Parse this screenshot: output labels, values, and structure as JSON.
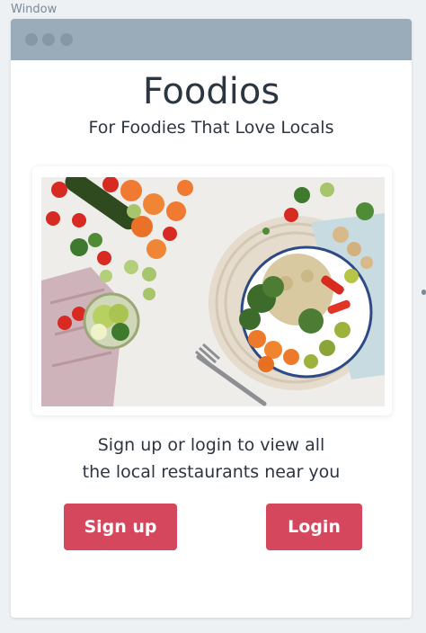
{
  "canvas": {
    "label": "Window"
  },
  "app": {
    "title": "Foodios",
    "tagline": "For Foodies That Love Locals"
  },
  "hero": {
    "icon": "food-photo"
  },
  "prompt": {
    "line1": "Sign up or login to view all",
    "line2": "the local restaurants near you"
  },
  "actions": {
    "signup_label": "Sign up",
    "login_label": "Login"
  },
  "colors": {
    "accent": "#d4475d",
    "titlebar": "#9aabb9",
    "text": "#2b3640",
    "background": "#eef1f4"
  }
}
